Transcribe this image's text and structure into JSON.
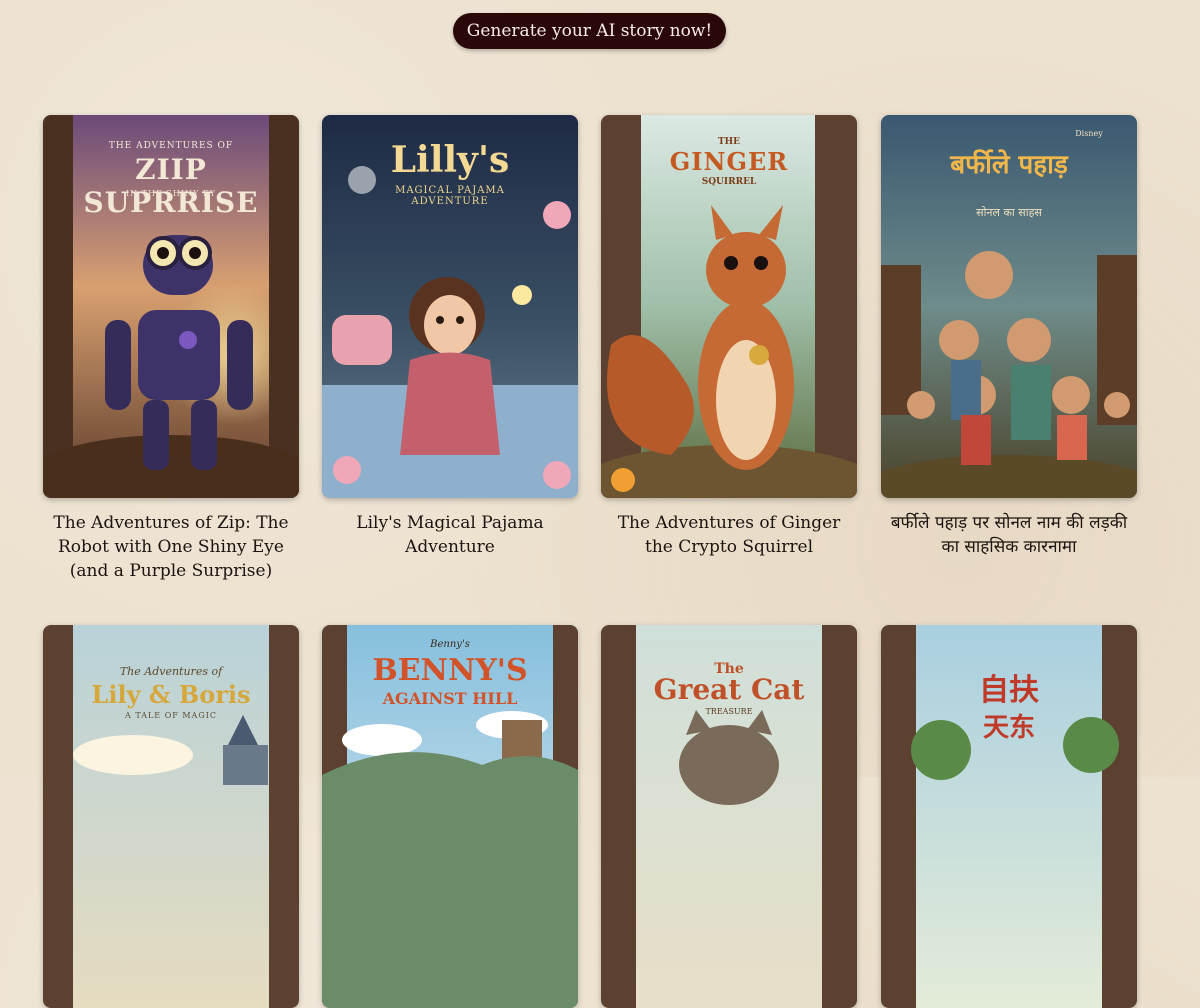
{
  "cta": {
    "label": "Generate your AI story now!"
  },
  "books": [
    {
      "title": "The Adventures of Zip: The Robot with One Shiny Eye (and a Purple Surprise)",
      "cover_kicker": "THE ADVENTURES OF",
      "cover_title": "ZIIP SUPRRISE",
      "cover_sub": "IN THE SHINY EY"
    },
    {
      "title": "Lily's Magical Pajama Adventure",
      "cover_title": "Lilly's",
      "cover_sub": "MAGICAL PAJAMA ADVENTURE"
    },
    {
      "title": "The Adventures of Ginger the Crypto Squirrel",
      "cover_kicker": "THE",
      "cover_title": "GINGER",
      "cover_sub": "SQUIRREL"
    },
    {
      "title": "बर्फीले पहाड़ पर सोनल नाम की लड़की का साहसिक कारनामा",
      "cover_kicker": "Disney",
      "cover_title": "बर्फीले पहाड़",
      "cover_sub": "सोनल का साहस"
    },
    {
      "cover_kicker": "The Adventures of",
      "cover_title": "Lily & Boris",
      "cover_sub": "A TALE OF MAGIC"
    },
    {
      "cover_kicker": "Benny's",
      "cover_title": "BENNY'S",
      "cover_sub": "AGAINST HILL"
    },
    {
      "cover_kicker": "The",
      "cover_title": "Great Cat",
      "cover_sub": "TREASURE"
    },
    {
      "cover_title": "自扶",
      "cover_sub": "天东"
    }
  ]
}
